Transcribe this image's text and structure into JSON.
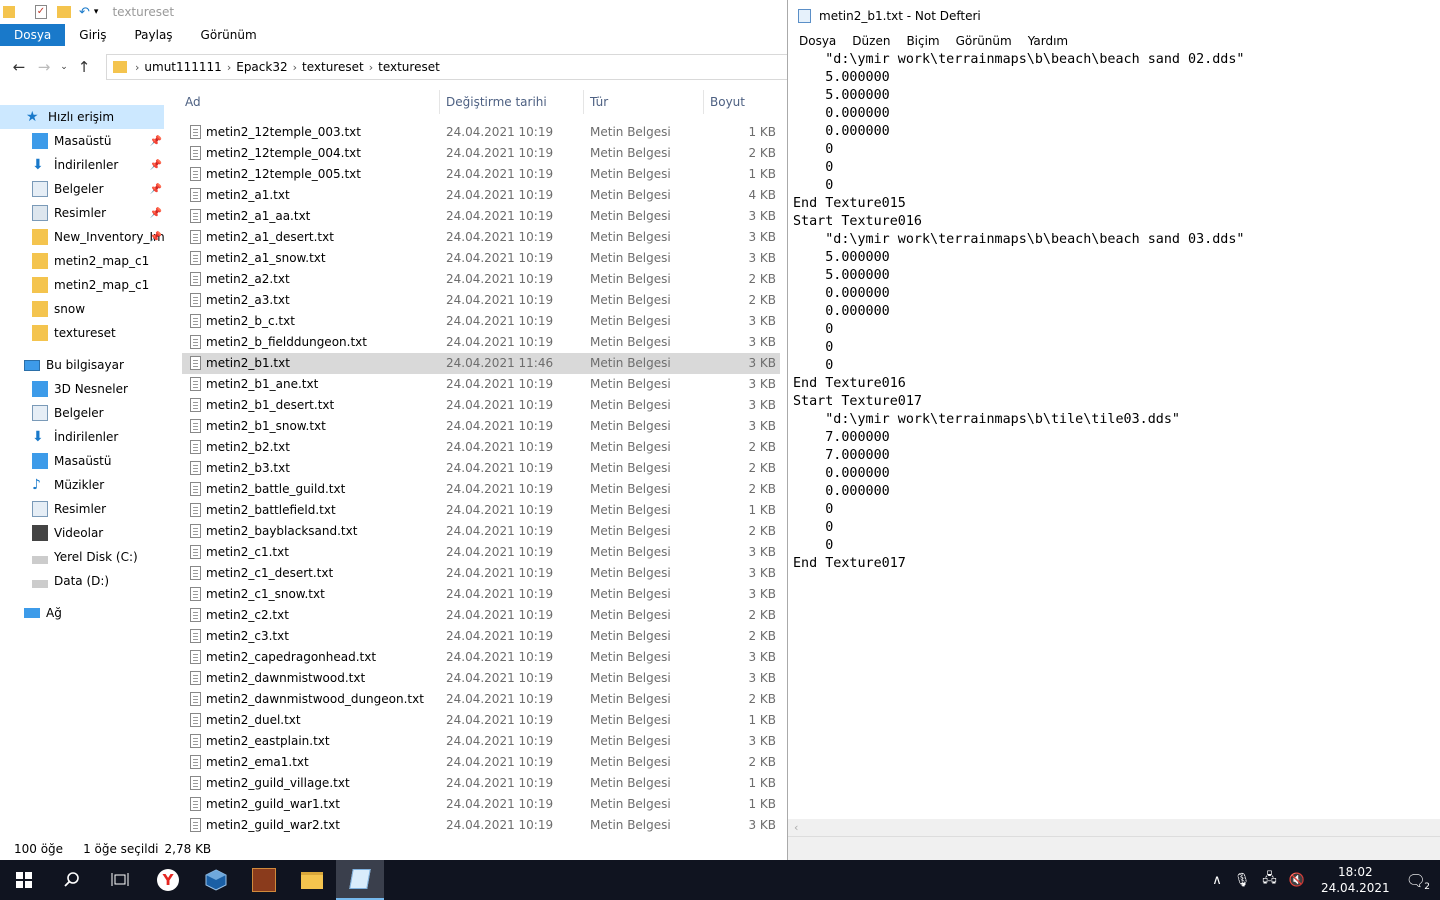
{
  "explorer": {
    "window_title": "textureset",
    "ribbon_tabs": [
      "Dosya",
      "Giriş",
      "Paylaş",
      "Görünüm"
    ],
    "breadcrumb": [
      "umut111111",
      "Epack32",
      "textureset",
      "textureset"
    ],
    "nav": {
      "quick_access": "Hızlı erişim",
      "quick_items": [
        "Masaüstü",
        "İndirilenler",
        "Belgeler",
        "Resimler",
        "New_Inventory_Im",
        "metin2_map_c1",
        "metin2_map_c1",
        "snow",
        "textureset"
      ],
      "this_pc": "Bu bilgisayar",
      "pc_items": [
        "3D Nesneler",
        "Belgeler",
        "İndirilenler",
        "Masaüstü",
        "Müzikler",
        "Resimler",
        "Videolar",
        "Yerel Disk (C:)",
        "Data (D:)"
      ],
      "network": "Ağ"
    },
    "columns": {
      "name": "Ad",
      "date": "Değiştirme tarihi",
      "type": "Tür",
      "size": "Boyut"
    },
    "files": [
      {
        "name": "metin2_12temple_003.txt",
        "date": "24.04.2021 10:19",
        "type": "Metin Belgesi",
        "size": "1 KB"
      },
      {
        "name": "metin2_12temple_004.txt",
        "date": "24.04.2021 10:19",
        "type": "Metin Belgesi",
        "size": "2 KB"
      },
      {
        "name": "metin2_12temple_005.txt",
        "date": "24.04.2021 10:19",
        "type": "Metin Belgesi",
        "size": "1 KB"
      },
      {
        "name": "metin2_a1.txt",
        "date": "24.04.2021 10:19",
        "type": "Metin Belgesi",
        "size": "4 KB"
      },
      {
        "name": "metin2_a1_aa.txt",
        "date": "24.04.2021 10:19",
        "type": "Metin Belgesi",
        "size": "3 KB"
      },
      {
        "name": "metin2_a1_desert.txt",
        "date": "24.04.2021 10:19",
        "type": "Metin Belgesi",
        "size": "3 KB"
      },
      {
        "name": "metin2_a1_snow.txt",
        "date": "24.04.2021 10:19",
        "type": "Metin Belgesi",
        "size": "3 KB"
      },
      {
        "name": "metin2_a2.txt",
        "date": "24.04.2021 10:19",
        "type": "Metin Belgesi",
        "size": "2 KB"
      },
      {
        "name": "metin2_a3.txt",
        "date": "24.04.2021 10:19",
        "type": "Metin Belgesi",
        "size": "2 KB"
      },
      {
        "name": "metin2_b_c.txt",
        "date": "24.04.2021 10:19",
        "type": "Metin Belgesi",
        "size": "3 KB"
      },
      {
        "name": "metin2_b_fielddungeon.txt",
        "date": "24.04.2021 10:19",
        "type": "Metin Belgesi",
        "size": "3 KB"
      },
      {
        "name": "metin2_b1.txt",
        "date": "24.04.2021 11:46",
        "type": "Metin Belgesi",
        "size": "3 KB"
      },
      {
        "name": "metin2_b1_ane.txt",
        "date": "24.04.2021 10:19",
        "type": "Metin Belgesi",
        "size": "3 KB"
      },
      {
        "name": "metin2_b1_desert.txt",
        "date": "24.04.2021 10:19",
        "type": "Metin Belgesi",
        "size": "3 KB"
      },
      {
        "name": "metin2_b1_snow.txt",
        "date": "24.04.2021 10:19",
        "type": "Metin Belgesi",
        "size": "3 KB"
      },
      {
        "name": "metin2_b2.txt",
        "date": "24.04.2021 10:19",
        "type": "Metin Belgesi",
        "size": "2 KB"
      },
      {
        "name": "metin2_b3.txt",
        "date": "24.04.2021 10:19",
        "type": "Metin Belgesi",
        "size": "2 KB"
      },
      {
        "name": "metin2_battle_guild.txt",
        "date": "24.04.2021 10:19",
        "type": "Metin Belgesi",
        "size": "2 KB"
      },
      {
        "name": "metin2_battlefield.txt",
        "date": "24.04.2021 10:19",
        "type": "Metin Belgesi",
        "size": "1 KB"
      },
      {
        "name": "metin2_bayblacksand.txt",
        "date": "24.04.2021 10:19",
        "type": "Metin Belgesi",
        "size": "2 KB"
      },
      {
        "name": "metin2_c1.txt",
        "date": "24.04.2021 10:19",
        "type": "Metin Belgesi",
        "size": "3 KB"
      },
      {
        "name": "metin2_c1_desert.txt",
        "date": "24.04.2021 10:19",
        "type": "Metin Belgesi",
        "size": "3 KB"
      },
      {
        "name": "metin2_c1_snow.txt",
        "date": "24.04.2021 10:19",
        "type": "Metin Belgesi",
        "size": "3 KB"
      },
      {
        "name": "metin2_c2.txt",
        "date": "24.04.2021 10:19",
        "type": "Metin Belgesi",
        "size": "2 KB"
      },
      {
        "name": "metin2_c3.txt",
        "date": "24.04.2021 10:19",
        "type": "Metin Belgesi",
        "size": "2 KB"
      },
      {
        "name": "metin2_capedragonhead.txt",
        "date": "24.04.2021 10:19",
        "type": "Metin Belgesi",
        "size": "3 KB"
      },
      {
        "name": "metin2_dawnmistwood.txt",
        "date": "24.04.2021 10:19",
        "type": "Metin Belgesi",
        "size": "3 KB"
      },
      {
        "name": "metin2_dawnmistwood_dungeon.txt",
        "date": "24.04.2021 10:19",
        "type": "Metin Belgesi",
        "size": "2 KB"
      },
      {
        "name": "metin2_duel.txt",
        "date": "24.04.2021 10:19",
        "type": "Metin Belgesi",
        "size": "1 KB"
      },
      {
        "name": "metin2_eastplain.txt",
        "date": "24.04.2021 10:19",
        "type": "Metin Belgesi",
        "size": "3 KB"
      },
      {
        "name": "metin2_ema1.txt",
        "date": "24.04.2021 10:19",
        "type": "Metin Belgesi",
        "size": "2 KB"
      },
      {
        "name": "metin2_guild_village.txt",
        "date": "24.04.2021 10:19",
        "type": "Metin Belgesi",
        "size": "1 KB"
      },
      {
        "name": "metin2_guild_war1.txt",
        "date": "24.04.2021 10:19",
        "type": "Metin Belgesi",
        "size": "1 KB"
      },
      {
        "name": "metin2_guild_war2.txt",
        "date": "24.04.2021 10:19",
        "type": "Metin Belgesi",
        "size": "3 KB"
      }
    ],
    "selected_file": "metin2_b1.txt",
    "status": {
      "count": "100 öğe",
      "selection": "1 öğe seçildi",
      "size": "2,78 KB"
    }
  },
  "notepad": {
    "title": "metin2_b1.txt - Not Defteri",
    "menu": [
      "Dosya",
      "Düzen",
      "Biçim",
      "Görünüm",
      "Yardım"
    ],
    "lines": [
      "    \"d:\\ymir work\\terrainmaps\\b\\beach\\beach sand 02.dds\"",
      "    5.000000",
      "    5.000000",
      "    0.000000",
      "    0.000000",
      "    0",
      "    0",
      "    0",
      "End Texture015",
      "Start Texture016",
      "    \"d:\\ymir work\\terrainmaps\\b\\beach\\beach sand 03.dds\"",
      "    5.000000",
      "    5.000000",
      "    0.000000",
      "    0.000000",
      "    0",
      "    0",
      "    0",
      "End Texture016",
      "Start Texture017",
      "    \"d:\\ymir work\\terrainmaps\\b\\tile\\tile03.dds\"",
      "    7.000000",
      "    7.000000",
      "    0.000000",
      "    0.000000",
      "    0",
      "    0",
      "    0",
      "End Texture017"
    ]
  },
  "taskbar": {
    "time": "18:02",
    "date": "24.04.2021",
    "notification_count": "2"
  },
  "colors": {
    "accent": "#1979ca",
    "selection": "#cce8ff",
    "row_selected": "#d9d9d9",
    "taskbar": "#101420"
  }
}
